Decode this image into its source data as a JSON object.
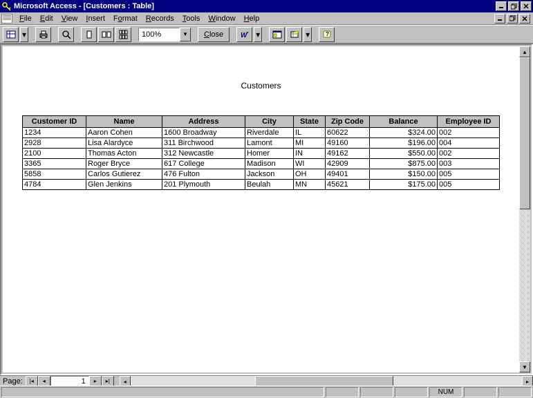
{
  "title": "Microsoft Access - [Customers : Table]",
  "menu": [
    "File",
    "Edit",
    "View",
    "Insert",
    "Format",
    "Records",
    "Tools",
    "Window",
    "Help"
  ],
  "zoom": "100%",
  "close_label": "Close",
  "report": {
    "title": "Customers",
    "columns": [
      "Customer ID",
      "Name",
      "Address",
      "City",
      "State",
      "Zip Code",
      "Balance",
      "Employee ID"
    ],
    "rows": [
      {
        "id": "1234",
        "name": "Aaron Cohen",
        "address": "1600 Broadway",
        "city": "Riverdale",
        "state": "IL",
        "zip": "60622",
        "balance": "$324.00",
        "emp": "002"
      },
      {
        "id": "2928",
        "name": "Lisa Alardyce",
        "address": "311 Birchwood",
        "city": "Lamont",
        "state": "MI",
        "zip": "49160",
        "balance": "$196.00",
        "emp": "004"
      },
      {
        "id": "2100",
        "name": "Thomas Acton",
        "address": "312 Newcastle",
        "city": "Homer",
        "state": "IN",
        "zip": "49162",
        "balance": "$550.00",
        "emp": "002"
      },
      {
        "id": "3365",
        "name": "Roger Bryce",
        "address": "617 College",
        "city": "Madison",
        "state": "WI",
        "zip": "42909",
        "balance": "$875.00",
        "emp": "003"
      },
      {
        "id": "5858",
        "name": "Carlos Gutierez",
        "address": "476 Fulton",
        "city": "Jackson",
        "state": "OH",
        "zip": "49401",
        "balance": "$150.00",
        "emp": "005"
      },
      {
        "id": "4784",
        "name": "Glen Jenkins",
        "address": "201 Plymouth",
        "city": "Beulah",
        "state": "MN",
        "zip": "45621",
        "balance": "$175.00",
        "emp": "005"
      }
    ]
  },
  "nav": {
    "label": "Page:",
    "value": "1"
  },
  "status": {
    "num": "NUM"
  }
}
